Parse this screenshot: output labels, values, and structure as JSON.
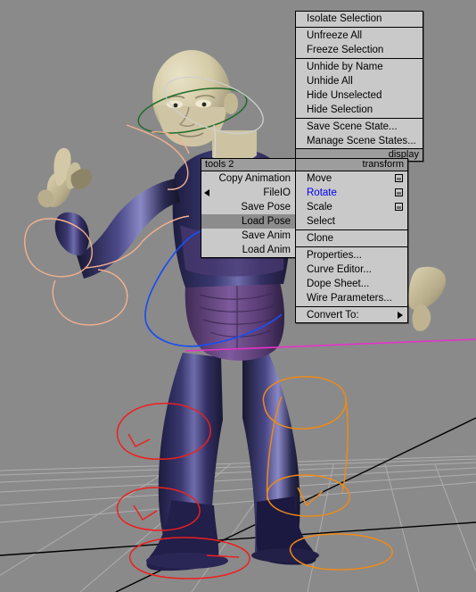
{
  "app": {
    "viewport_background": "#8a8a8a",
    "grid_color": "#bdbdbd",
    "axis_color": "#000000"
  },
  "quad_menus": {
    "display": {
      "title": "display",
      "title_position": "bottom",
      "items": [
        {
          "label": "Isolate Selection",
          "separator_after": true
        },
        {
          "label": "Unfreeze All"
        },
        {
          "label": "Freeze Selection",
          "separator_after": true
        },
        {
          "label": "Unhide by Name"
        },
        {
          "label": "Unhide All"
        },
        {
          "label": "Hide Unselected"
        },
        {
          "label": "Hide Selection",
          "separator_after": true
        },
        {
          "label": "Save Scene State..."
        },
        {
          "label": "Manage Scene States..."
        }
      ]
    },
    "tools2": {
      "title": "tools 2",
      "title_position": "top",
      "items": [
        {
          "label": "Copy Animation"
        },
        {
          "label": "FileIO",
          "submarker": "left-arrow"
        },
        {
          "label": "Save Pose"
        },
        {
          "label": "Load Pose",
          "highlighted": true
        },
        {
          "label": "Save Anim"
        },
        {
          "label": "Load Anim"
        }
      ]
    },
    "transform": {
      "title": "transform",
      "title_position": "top",
      "items": [
        {
          "label": "Move",
          "dialog_box": true
        },
        {
          "label": "Rotate",
          "dialog_box": true,
          "active": true
        },
        {
          "label": "Scale",
          "dialog_box": true
        },
        {
          "label": "Select",
          "separator_after": true
        },
        {
          "label": "Clone",
          "accel": "C",
          "separator_after": true
        },
        {
          "label": "Properties...",
          "accel": "P"
        },
        {
          "label": "Curve Editor...",
          "accel": "C"
        },
        {
          "label": "Dope Sheet...",
          "accel": "D"
        },
        {
          "label": "Wire Parameters...",
          "accel": "W",
          "separator_after": true
        },
        {
          "label": "Convert To:",
          "submarker": "right-arrow"
        }
      ]
    }
  },
  "scene": {
    "character": {
      "suit_color": "#2b2a58",
      "suit_highlight": "#6f6ea8",
      "abdomen_color": "#6a4a86",
      "skin_color": "#d8cfae",
      "skin_shadow": "#9d9377"
    },
    "helpers": [
      {
        "name": "head-rotation-gizmo",
        "color": "#1f6b2a"
      },
      {
        "name": "head-rotation-gizmo-alt",
        "color": "#cfcfcf"
      },
      {
        "name": "arm-bone-shapes",
        "color": "#f4b08e"
      },
      {
        "name": "spine-spline",
        "color": "#1a4ef0"
      },
      {
        "name": "pelvis-line",
        "color": "#e632c8"
      },
      {
        "name": "left-leg-shapes",
        "color": "#ee1f1f"
      },
      {
        "name": "right-leg-shapes",
        "color": "#ef8a16"
      }
    ]
  }
}
